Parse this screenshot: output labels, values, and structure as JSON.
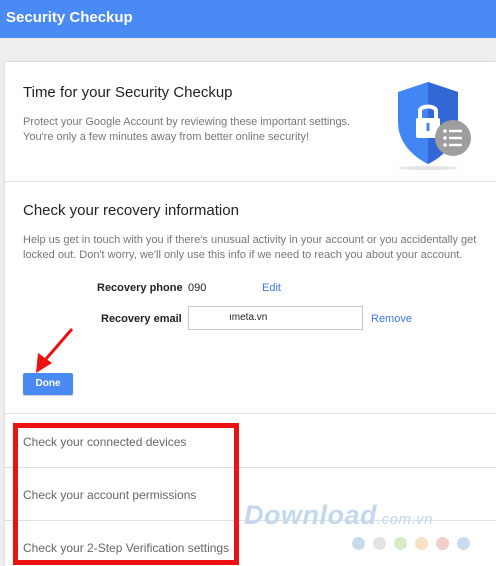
{
  "app": {
    "title": "Security Checkup"
  },
  "intro": {
    "title": "Time for your Security Checkup",
    "description": "Protect your Google Account by reviewing these important settings. You're only a few minutes away from better online security!"
  },
  "recovery": {
    "title": "Check your recovery information",
    "description": "Help us get in touch with you if there's unusual activity in your account or you accidentally get locked out. Don't worry, we'll only use this info if we need to reach you about your account.",
    "phone_label": "Recovery phone",
    "phone_value": "090",
    "phone_action": "Edit",
    "email_label": "Recovery email",
    "email_value": "ımeta.vn",
    "email_action": "Remove",
    "done_label": "Done"
  },
  "checks": [
    {
      "label": "Check your connected devices"
    },
    {
      "label": "Check your account permissions"
    },
    {
      "label": "Check your 2-Step Verification settings"
    }
  ],
  "watermark": {
    "brand": "Download",
    "suffix": ".com.vn"
  },
  "colors": {
    "accent": "#4a8af4",
    "link": "#3b78e7",
    "annotation_red": "#ee1111",
    "shield": "#4285f4",
    "shield_dark": "#3367d6"
  },
  "icons": {
    "shield": "shield-lock-icon",
    "list_badge": "list-icon",
    "arrow": "red-arrow-annotation"
  }
}
